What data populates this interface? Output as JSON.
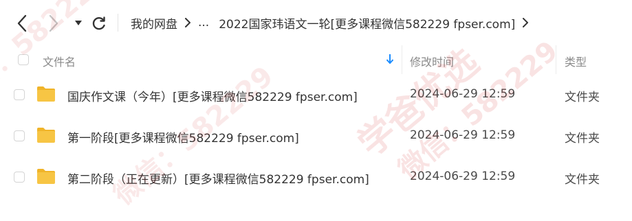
{
  "breadcrumb": {
    "root": "我的网盘",
    "ellipsis": "...",
    "current": "2022国家玮语文一轮[更多课程微信582229 fpser.com]"
  },
  "columns": {
    "name": "文件名",
    "modified": "修改时间",
    "type": "类型"
  },
  "rows": [
    {
      "name": "国庆作文课（今年）[更多课程微信582229 fpser.com]",
      "modified": "2024-06-29 12:59",
      "type": "文件夹"
    },
    {
      "name": "第一阶段[更多课程微信582229 fpser.com]",
      "modified": "2024-06-29 12:59",
      "type": "文件夹"
    },
    {
      "name": "第二阶段（正在更新）[更多课程微信582229 fpser.com]",
      "modified": "2024-06-29 12:59",
      "type": "文件夹"
    }
  ],
  "watermark": {
    "line1": "学爸优选",
    "line2": "微信：582229"
  },
  "colors": {
    "folder": "#f7c544",
    "accent": "#1a8cff",
    "watermark": "#d32f2f"
  },
  "icons": [
    "back-arrow-icon",
    "forward-arrow-icon",
    "dropdown-caret-icon",
    "refresh-icon",
    "chevron-right-icon",
    "sort-down-arrow-icon",
    "folder-icon"
  ]
}
